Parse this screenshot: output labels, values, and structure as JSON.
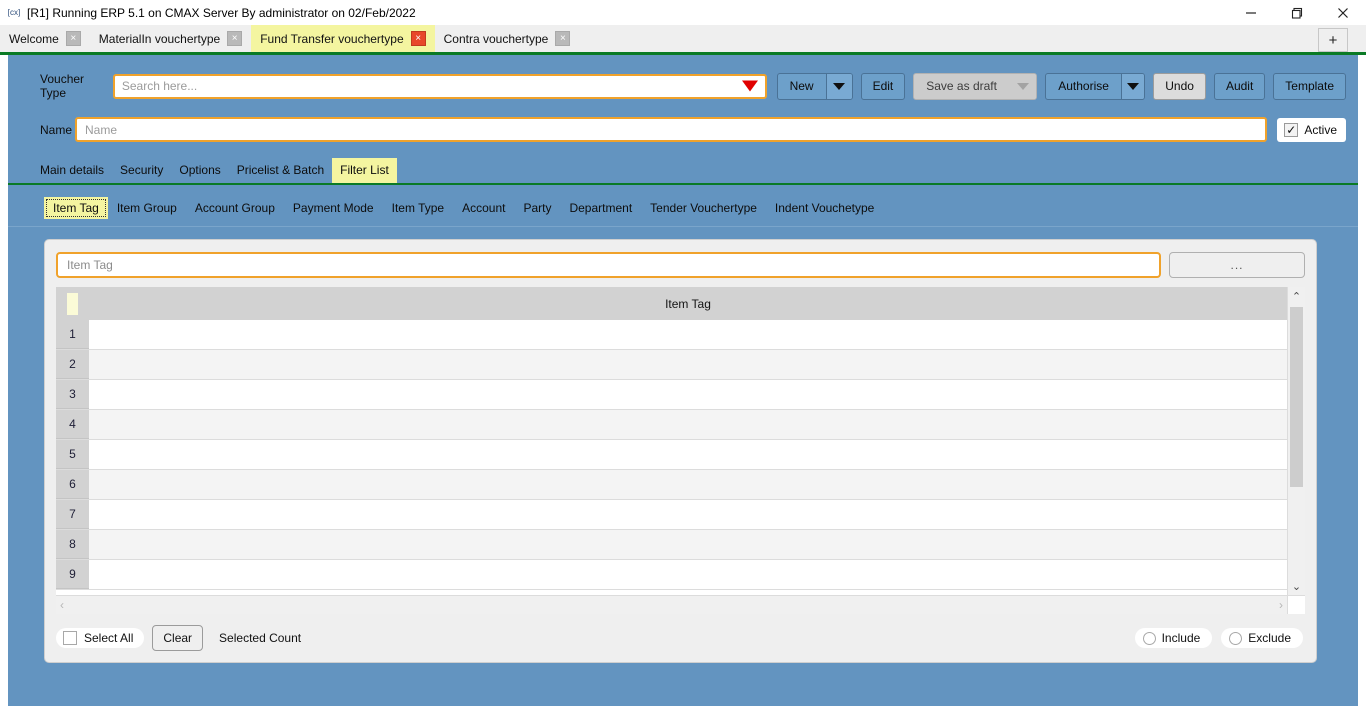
{
  "window": {
    "title": "[R1] Running ERP 5.1 on CMAX Server By administrator on 02/Feb/2022",
    "app_icon": "application-icon",
    "minimize_label": "minimize-icon",
    "maximize_label": "restore-icon",
    "close_label": "close-icon"
  },
  "tabs": {
    "items": [
      {
        "label": "Welcome",
        "active": false,
        "close": "×"
      },
      {
        "label": "MaterialIn vouchertype",
        "active": false,
        "close": "×"
      },
      {
        "label": "Fund Transfer vouchertype",
        "active": true,
        "close": "×"
      },
      {
        "label": "Contra vouchertype",
        "active": false,
        "close": "×"
      }
    ],
    "new_tab_label": "+"
  },
  "toolbar": {
    "voucher_type_label": "Voucher Type",
    "search_placeholder": "Search here...",
    "search_value": "",
    "new_label": "New",
    "edit_label": "Edit",
    "save_as_draft_label": "Save as draft",
    "authorise_label": "Authorise",
    "undo_label": "Undo",
    "audit_label": "Audit",
    "template_label": "Template"
  },
  "name_row": {
    "name_label": "Name",
    "name_placeholder": "Name",
    "name_value": "",
    "active_label": "Active",
    "active_checked": true,
    "check_glyph": "✓"
  },
  "primary_tabs": {
    "items": [
      {
        "label": "Main details",
        "active": false
      },
      {
        "label": "Security",
        "active": false
      },
      {
        "label": "Options",
        "active": false
      },
      {
        "label": "Pricelist & Batch",
        "active": false
      },
      {
        "label": "Filter List",
        "active": true
      }
    ]
  },
  "filter_tabs": {
    "items": [
      {
        "label": "Item Tag",
        "active": true
      },
      {
        "label": "Item Group",
        "active": false
      },
      {
        "label": "Account Group",
        "active": false
      },
      {
        "label": "Payment Mode",
        "active": false
      },
      {
        "label": "Item Type",
        "active": false
      },
      {
        "label": "Account",
        "active": false
      },
      {
        "label": "Party",
        "active": false
      },
      {
        "label": "Department",
        "active": false
      },
      {
        "label": "Tender Vouchertype",
        "active": false
      },
      {
        "label": "Indent Vouchetype",
        "active": false
      }
    ]
  },
  "filter_panel": {
    "tag_placeholder": "Item Tag",
    "tag_value": "",
    "browse_label": "...",
    "grid": {
      "column_header": "Item Tag",
      "rows": [
        {
          "num": "1",
          "value": ""
        },
        {
          "num": "2",
          "value": ""
        },
        {
          "num": "3",
          "value": ""
        },
        {
          "num": "4",
          "value": ""
        },
        {
          "num": "5",
          "value": ""
        },
        {
          "num": "6",
          "value": ""
        },
        {
          "num": "7",
          "value": ""
        },
        {
          "num": "8",
          "value": ""
        },
        {
          "num": "9",
          "value": ""
        }
      ],
      "scroll_up": "⌃",
      "scroll_down": "⌄",
      "scroll_left": "‹",
      "scroll_right": "›"
    },
    "footer": {
      "select_all_label": "Select All",
      "select_all_checked": false,
      "clear_label": "Clear",
      "selected_count_label": "Selected Count",
      "include_label": "Include",
      "include_selected": false,
      "exclude_label": "Exclude",
      "exclude_selected": false
    }
  },
  "colors": {
    "app_blue": "#6394c0",
    "accent_yellow": "#f4f5a0",
    "field_orange": "#f0a22b",
    "separator_green": "#0a7a25",
    "close_red": "#e8482a"
  }
}
